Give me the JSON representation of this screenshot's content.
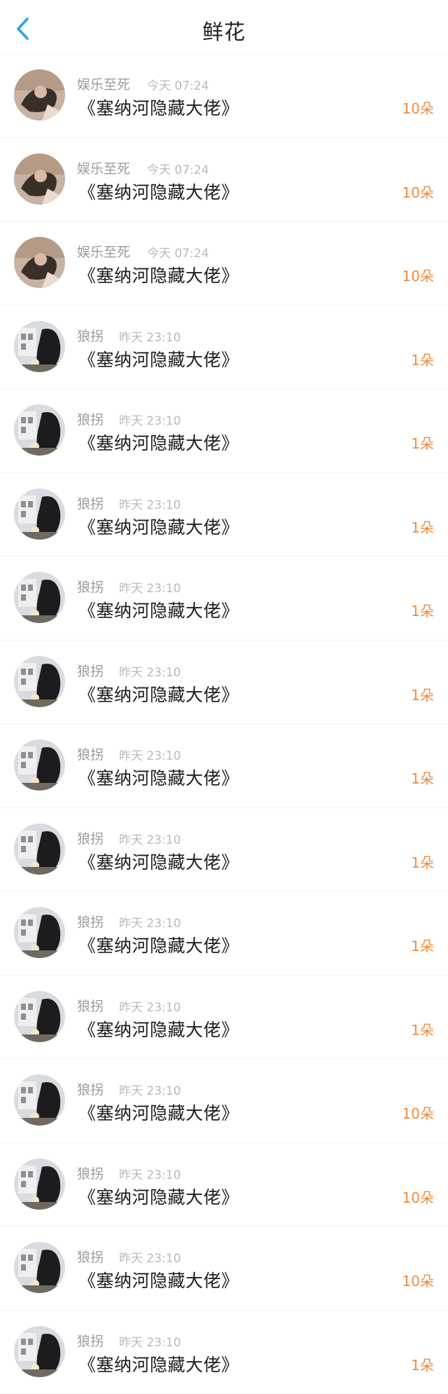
{
  "header": {
    "title": "鲜花",
    "back_icon": "chevron-left-icon",
    "accent_color": "#2aa3e6"
  },
  "rows": [
    {
      "name": "娱乐至死",
      "time": "今天 07:24",
      "book": "《塞纳河隐藏大佬》",
      "count": "10朵",
      "avatar": "a"
    },
    {
      "name": "娱乐至死",
      "time": "今天 07:24",
      "book": "《塞纳河隐藏大佬》",
      "count": "10朵",
      "avatar": "a"
    },
    {
      "name": "娱乐至死",
      "time": "今天 07:24",
      "book": "《塞纳河隐藏大佬》",
      "count": "10朵",
      "avatar": "a"
    },
    {
      "name": "狼拐",
      "time": "昨天 23:10",
      "book": "《塞纳河隐藏大佬》",
      "count": "1朵",
      "avatar": "b"
    },
    {
      "name": "狼拐",
      "time": "昨天 23:10",
      "book": "《塞纳河隐藏大佬》",
      "count": "1朵",
      "avatar": "b"
    },
    {
      "name": "狼拐",
      "time": "昨天 23:10",
      "book": "《塞纳河隐藏大佬》",
      "count": "1朵",
      "avatar": "b"
    },
    {
      "name": "狼拐",
      "time": "昨天 23:10",
      "book": "《塞纳河隐藏大佬》",
      "count": "1朵",
      "avatar": "b"
    },
    {
      "name": "狼拐",
      "time": "昨天 23:10",
      "book": "《塞纳河隐藏大佬》",
      "count": "1朵",
      "avatar": "b"
    },
    {
      "name": "狼拐",
      "time": "昨天 23:10",
      "book": "《塞纳河隐藏大佬》",
      "count": "1朵",
      "avatar": "b"
    },
    {
      "name": "狼拐",
      "time": "昨天 23:10",
      "book": "《塞纳河隐藏大佬》",
      "count": "1朵",
      "avatar": "b"
    },
    {
      "name": "狼拐",
      "time": "昨天 23:10",
      "book": "《塞纳河隐藏大佬》",
      "count": "1朵",
      "avatar": "b"
    },
    {
      "name": "狼拐",
      "time": "昨天 23:10",
      "book": "《塞纳河隐藏大佬》",
      "count": "1朵",
      "avatar": "b"
    },
    {
      "name": "狼拐",
      "time": "昨天 23:10",
      "book": "《塞纳河隐藏大佬》",
      "count": "10朵",
      "avatar": "b"
    },
    {
      "name": "狼拐",
      "time": "昨天 23:10",
      "book": "《塞纳河隐藏大佬》",
      "count": "10朵",
      "avatar": "b"
    },
    {
      "name": "狼拐",
      "time": "昨天 23:10",
      "book": "《塞纳河隐藏大佬》",
      "count": "10朵",
      "avatar": "b"
    },
    {
      "name": "狼拐",
      "time": "昨天 23:10",
      "book": "《塞纳河隐藏大佬》",
      "count": "1朵",
      "avatar": "b"
    }
  ]
}
